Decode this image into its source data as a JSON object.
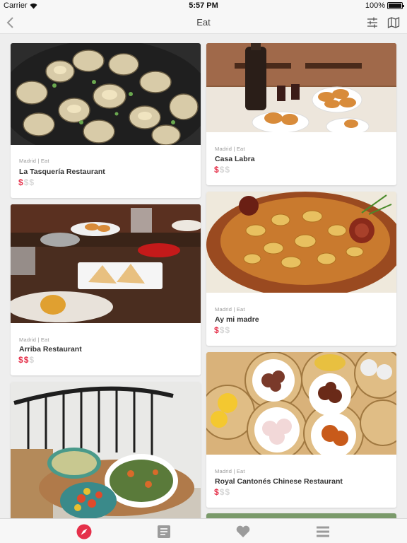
{
  "status_bar": {
    "carrier": "Carrier",
    "time": "5:57 PM",
    "battery": "100%"
  },
  "nav": {
    "title": "Eat",
    "back_icon": "chevron-left-icon",
    "filter_icon": "sliders-icon",
    "map_icon": "map-icon"
  },
  "cards": [
    {
      "location": "Madrid | Eat",
      "name": "La Tasquería Restaurant",
      "price_level": 1,
      "price_max": 3,
      "image": "clams-dish-photo"
    },
    {
      "location": "Madrid | Eat",
      "name": "Casa Labra",
      "price_level": 1,
      "price_max": 3,
      "image": "bar-table-croquettes-photo"
    },
    {
      "location": "Madrid | Eat",
      "name": "Arriba Restaurant",
      "price_level": 2,
      "price_max": 3,
      "image": "restaurant-table-photo"
    },
    {
      "location": "Madrid | Eat",
      "name": "Ay mi madre",
      "price_level": 1,
      "price_max": 3,
      "image": "stew-bowl-photo"
    },
    {
      "location": "",
      "name": "",
      "price_level": 0,
      "price_max": 3,
      "image": "salad-bowls-chair-photo"
    },
    {
      "location": "Madrid | Eat",
      "name": "Royal Cantonés Chinese Restaurant",
      "price_level": 1,
      "price_max": 3,
      "image": "dim-sum-photo"
    }
  ],
  "tab_bar": {
    "items": [
      {
        "icon": "compass-icon",
        "active": true
      },
      {
        "icon": "document-icon",
        "active": false
      },
      {
        "icon": "heart-icon",
        "active": false
      },
      {
        "icon": "menu-icon",
        "active": false
      }
    ]
  },
  "colors": {
    "accent": "#e5304a",
    "inactive_tab": "#9b9b9b",
    "background": "#eeeeee"
  }
}
